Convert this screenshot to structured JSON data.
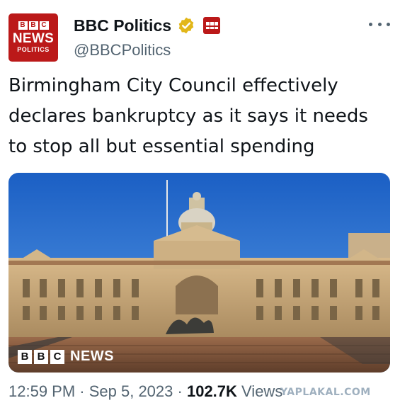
{
  "avatar": {
    "blocks": [
      "B",
      "B",
      "C"
    ],
    "news": "NEWS",
    "sub": "POLITICS"
  },
  "author": {
    "display_name": "BBC Politics",
    "handle": "@BBCPolitics",
    "verified": true,
    "verified_color": "#e2b719",
    "affiliation_color": "#bb1919"
  },
  "tweet": {
    "text": "Birmingham City Council effectively declares bankruptcy as it says it needs to stop all but essential spending"
  },
  "media": {
    "logo_blocks": [
      "B",
      "B",
      "C"
    ],
    "logo_text": "NEWS"
  },
  "meta": {
    "time": "12:59 PM",
    "sep": " · ",
    "date": "Sep 5, 2023",
    "views_count": "102.7K",
    "views_label": " Views"
  },
  "watermark": "YAPLAKAL.COM",
  "icons": {
    "verified": "verified-badge-icon",
    "more": "more-options-icon"
  }
}
